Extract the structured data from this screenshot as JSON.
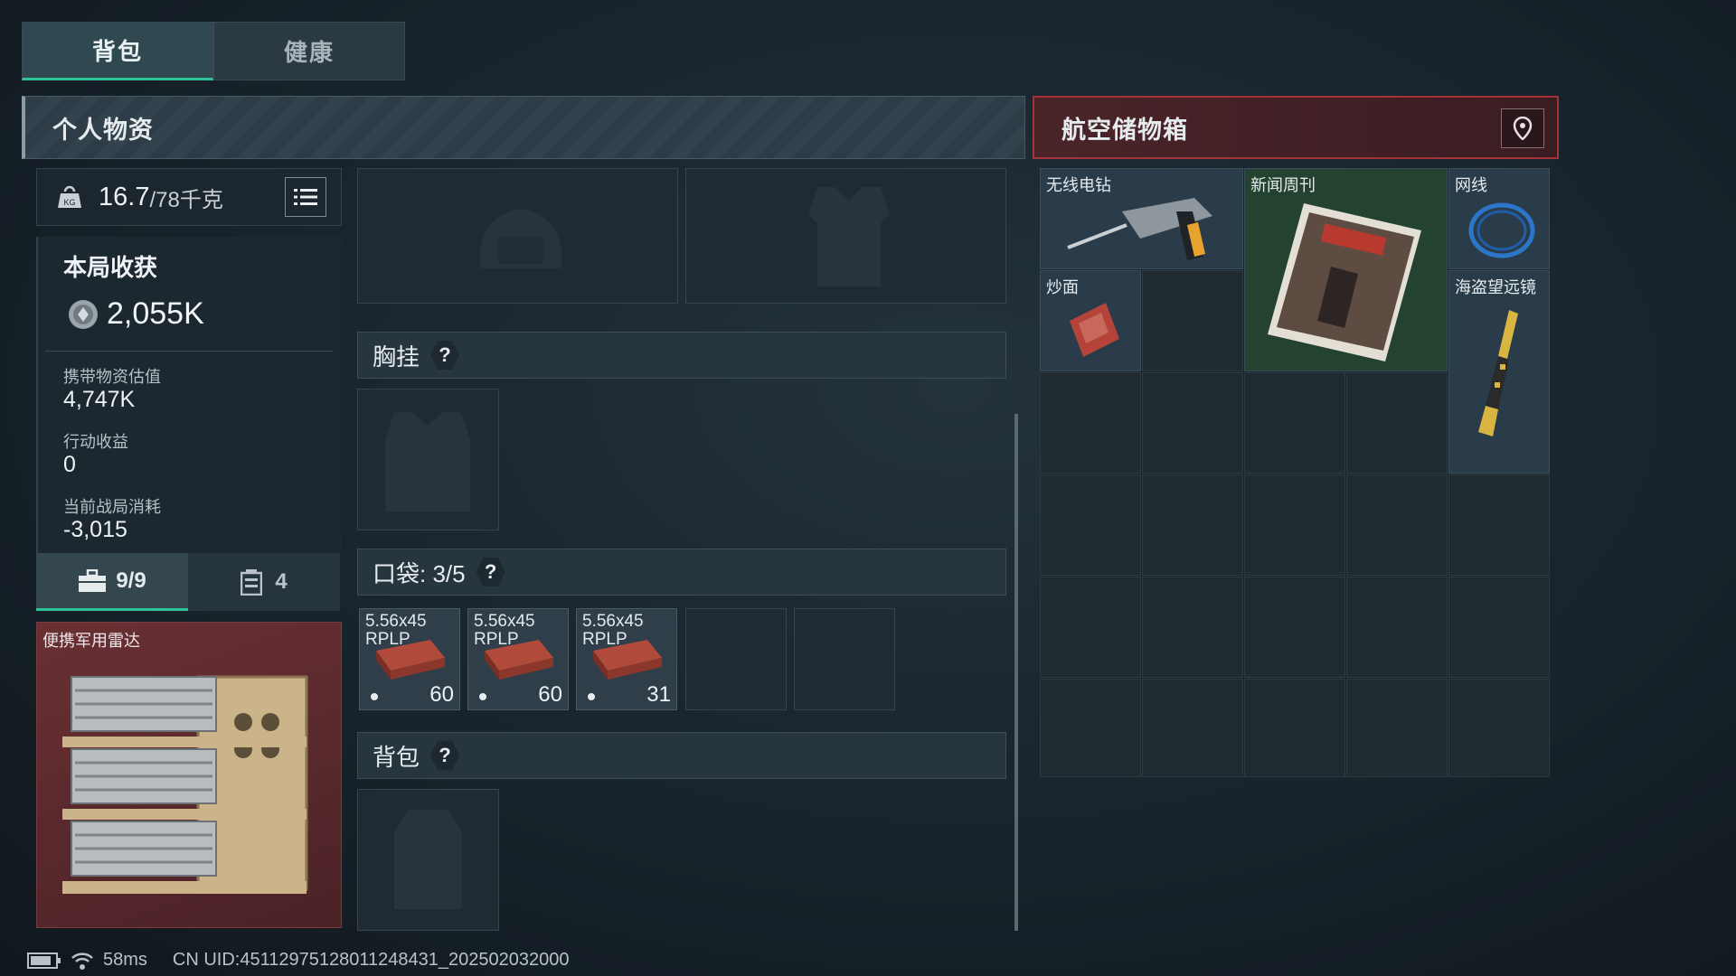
{
  "tabs": {
    "backpack": "背包",
    "health": "健康"
  },
  "left_header": "个人物资",
  "right_header": "航空储物箱",
  "weight": {
    "current": "16.7",
    "max": "/78千克"
  },
  "stats": {
    "harvest_title": "本局收获",
    "harvest_value": "2,055K",
    "carry_label": "携带物资估值",
    "carry_value": "4,747K",
    "income_label": "行动收益",
    "income_value": "0",
    "cost_label": "当前战局消耗",
    "cost_value": "-3,015"
  },
  "subtabs": {
    "case_count": "9/9",
    "box_count": "4"
  },
  "item_card": {
    "name": "便携军用雷达"
  },
  "sections": {
    "chest": "胸挂",
    "pocket": "口袋: 3/5",
    "bag": "背包",
    "help": "?"
  },
  "ammo": [
    {
      "line1": "5.56x45",
      "line2": "RPLP",
      "count": "60"
    },
    {
      "line1": "5.56x45",
      "line2": "RPLP",
      "count": "60"
    },
    {
      "line1": "5.56x45",
      "line2": "RPLP",
      "count": "31"
    }
  ],
  "storage_items": {
    "drill": "无线电钻",
    "magazine": "新闻周刊",
    "cable": "网线",
    "noodles": "炒面",
    "telescope": "海盗望远镜"
  },
  "status": {
    "ping": "58ms",
    "uid": "CN UID:4511297512801124843​1_202502032000"
  },
  "colors": {
    "accent_green": "#2fc39a",
    "container_red": "#a3323a"
  }
}
